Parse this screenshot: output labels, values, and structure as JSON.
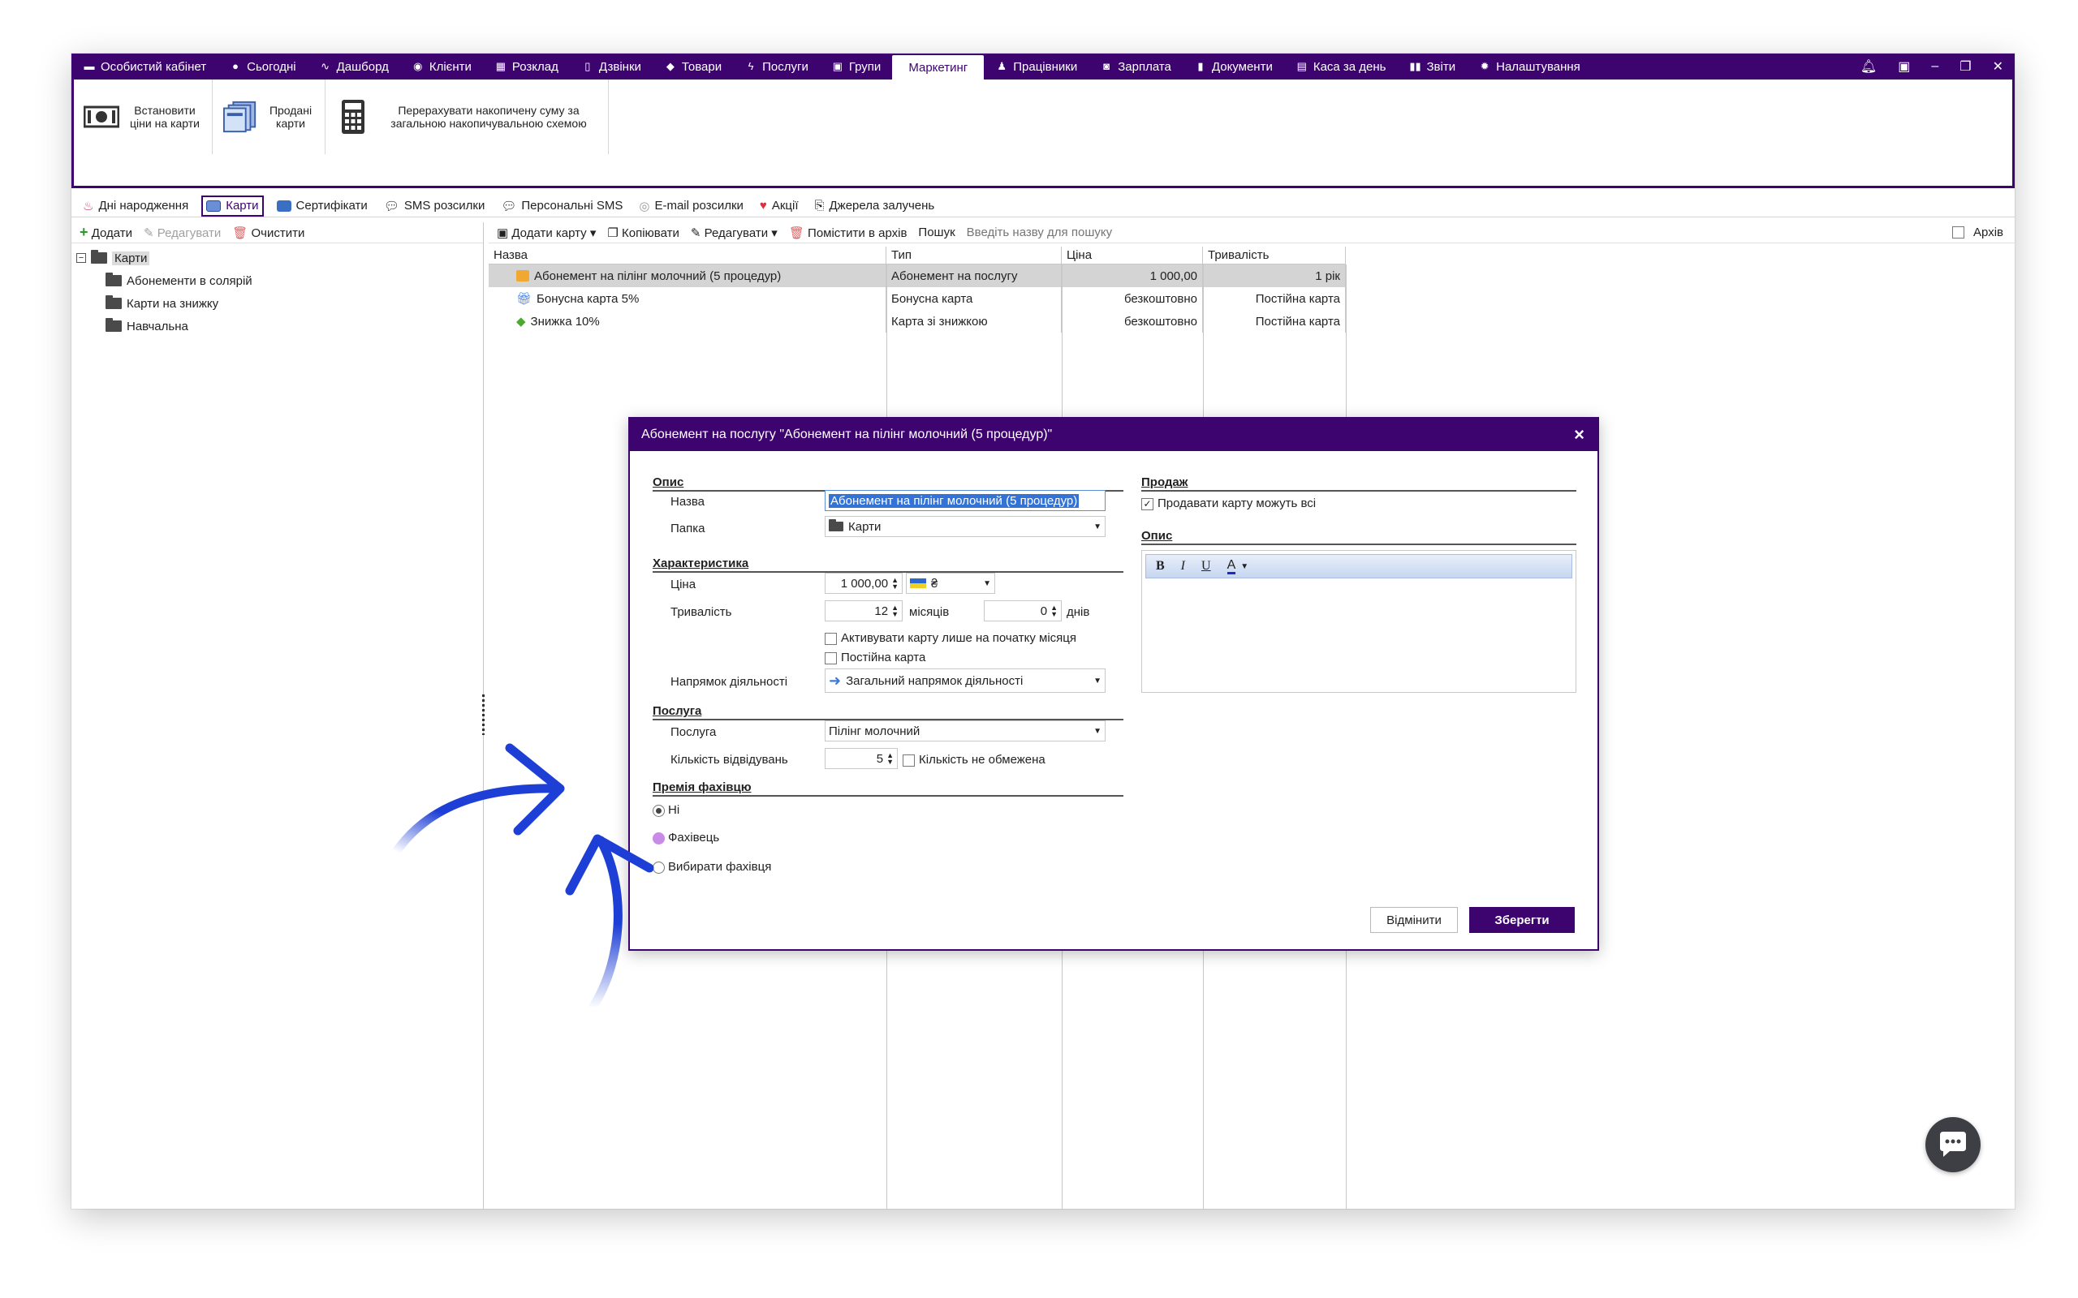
{
  "topnav": {
    "tabs": [
      {
        "label": "Особистий кабінет",
        "icon": "wallet-icon"
      },
      {
        "label": "Сьогодні",
        "icon": "clock-icon"
      },
      {
        "label": "Дашборд",
        "icon": "pulse-icon"
      },
      {
        "label": "Клієнти",
        "icon": "user-circle-icon"
      },
      {
        "label": "Розклад",
        "icon": "calendar-icon"
      },
      {
        "label": "Дзвінки",
        "icon": "phone-icon"
      },
      {
        "label": "Товари",
        "icon": "box-icon"
      },
      {
        "label": "Послуги",
        "icon": "bolt-icon"
      },
      {
        "label": "Групи",
        "icon": "group-icon"
      },
      {
        "label": "Маркетинг",
        "icon": ""
      },
      {
        "label": "Працівники",
        "icon": "person-icon"
      },
      {
        "label": "Зарплата",
        "icon": "money-icon"
      },
      {
        "label": "Документи",
        "icon": "document-icon"
      },
      {
        "label": "Каса за день",
        "icon": "calculator-icon"
      },
      {
        "label": "Звіти",
        "icon": "bar-chart-icon"
      },
      {
        "label": "Налаштування",
        "icon": "gear-icon"
      }
    ],
    "active": "Маркетинг"
  },
  "ribbon": {
    "set_prices": "Встановити ціни на карти",
    "sold_cards": "Продані карти",
    "recalc": "Перерахувати накопичену суму за загальною накопичувальною схемою"
  },
  "subnav": {
    "items": [
      "Дні народження",
      "Карти",
      "Сертифікати",
      "SMS розсилки",
      "Персональні SMS",
      "E-mail розсилки",
      "Акції",
      "Джерела залучень"
    ],
    "active": "Карти"
  },
  "left": {
    "add": "Додати",
    "edit": "Редагувати",
    "clear": "Очистити",
    "tree_root": "Карти",
    "folders": [
      "Абонементи в солярій",
      "Карти на знижку",
      "Навчальна"
    ]
  },
  "right": {
    "add_card": "Додати карту",
    "copy": "Копіювати",
    "edit": "Редагувати",
    "archive_move": "Помістити в архів",
    "search_label": "Пошук",
    "search_placeholder": "Введіть назву для пошуку",
    "archive": "Архів",
    "columns": [
      "Назва",
      "Тип",
      "Ціна",
      "Тривалість"
    ],
    "rows": [
      {
        "name": "Абонемент на пілінг молочний (5 процедур)",
        "type": "Абонемент на послугу",
        "price": "1 000,00",
        "duration": "1 рік"
      },
      {
        "name": "Бонусна карта 5%",
        "type": "Бонусна карта",
        "price": "безкоштовно",
        "duration": "Постійна карта"
      },
      {
        "name": "Знижка 10%",
        "type": "Карта зі знижкою",
        "price": "безкоштовно",
        "duration": "Постійна карта"
      }
    ]
  },
  "dialog": {
    "title": "Абонемент на послугу \"Абонемент на пілінг молочний (5 процедур)\"",
    "sec_desc": "Опис",
    "name_label": "Назва",
    "name_value": "Абонемент на пілінг молочний (5 процедур)",
    "folder_label": "Папка",
    "folder_value": "Карти",
    "sec_char": "Характеристика",
    "price_label": "Ціна",
    "price_value": "1 000,00",
    "currency": "₴",
    "duration_label": "Тривалість",
    "months_value": "12",
    "months_unit": "місяців",
    "days_value": "0",
    "days_unit": "днів",
    "activate_start": "Активувати карту лише на початку місяця",
    "permanent": "Постійна карта",
    "direction_label": "Напрямок діяльності",
    "direction_value": "Загальний напрямок діяльності",
    "sec_service": "Послуга",
    "service_label": "Послуга",
    "service_value": "Пілінг молочний",
    "visits_label": "Кількість відвідувань",
    "visits_value": "5",
    "unlimited": "Кількість не обмежена",
    "sec_bonus": "Премія фахівцю",
    "opt_no": "Ні",
    "opt_specialist": "Фахівець",
    "opt_choose": "Вибирати фахівця",
    "sec_sale": "Продаж",
    "sale_all": "Продавати карту можуть всі",
    "sec_desc2": "Опис",
    "cancel": "Відмінити",
    "save": "Зберегти"
  },
  "colors": {
    "brand": "#3d0470",
    "arrow": "#1d3fd6"
  }
}
